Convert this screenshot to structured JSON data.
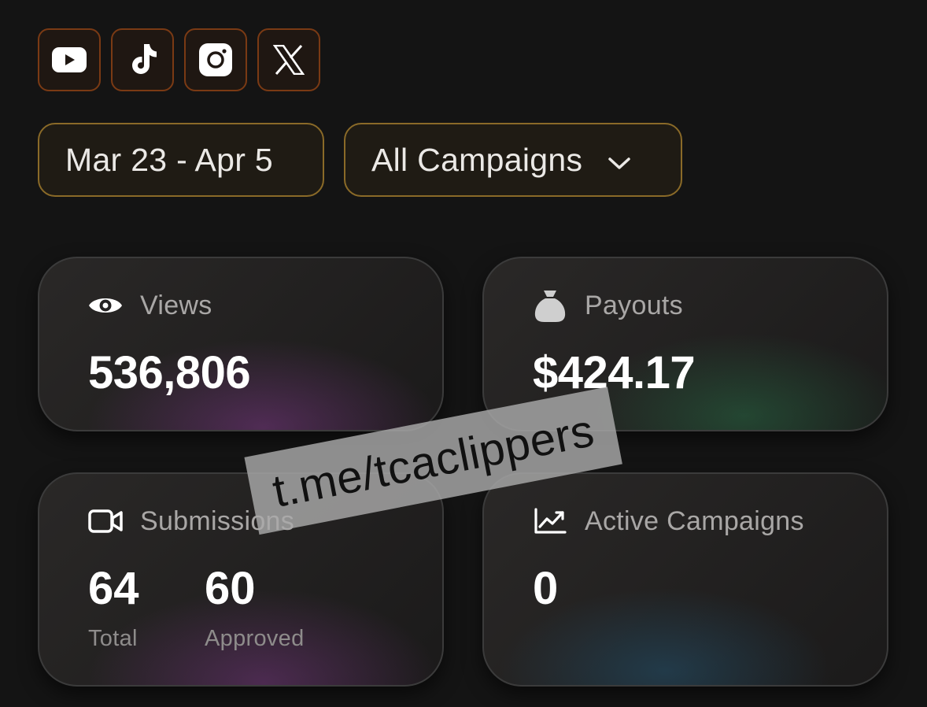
{
  "platforms": [
    {
      "name": "youtube",
      "icon": "youtube-icon"
    },
    {
      "name": "tiktok",
      "icon": "tiktok-icon"
    },
    {
      "name": "instagram",
      "icon": "instagram-icon"
    },
    {
      "name": "x",
      "icon": "x-icon"
    }
  ],
  "filters": {
    "date_range": "Mar 23 - Apr 5",
    "campaign": "All Campaigns"
  },
  "cards": {
    "views": {
      "label": "Views",
      "value": "536,806",
      "icon": "eye-icon"
    },
    "payouts": {
      "label": "Payouts",
      "value": "$424.17",
      "icon": "money-bag-icon"
    },
    "submissions": {
      "label": "Submissions",
      "icon": "video-camera-icon",
      "total": "64",
      "total_label": "Total",
      "approved": "60",
      "approved_label": "Approved"
    },
    "active_campaigns": {
      "label": "Active Campaigns",
      "value": "0",
      "icon": "chart-up-icon"
    }
  },
  "watermark": "t.me/tcaclippers",
  "colors": {
    "background": "#141414",
    "platform_border": "#7a3a14",
    "filter_border": "#8a6a28",
    "label": "#a9a7a6",
    "value": "#ffffff"
  }
}
